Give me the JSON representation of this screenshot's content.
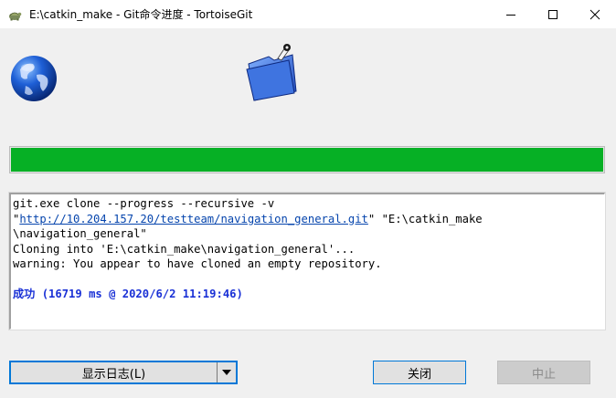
{
  "window": {
    "title": "E:\\catkin_make - Git命令进度 - TortoiseGit",
    "icon": "tortoise-icon",
    "controls": [
      "minimize-icon",
      "maximize-icon",
      "close-icon"
    ]
  },
  "header": {
    "left_icon": "globe-icon",
    "right_icon": "folder-icon"
  },
  "progress": {
    "percent": 100,
    "color": "#06b025"
  },
  "log": {
    "line1": "git.exe clone --progress --recursive -v",
    "line2_q1": "\"",
    "line2_link": "http://10.204.157.20/testteam/navigation_general.git",
    "line2_rest": "\" \"E:\\catkin_make",
    "line3": "\\navigation_general\"",
    "line4": "Cloning into 'E:\\catkin_make\\navigation_general'...",
    "line5": "warning: You appear to have cloned an empty repository.",
    "success": "成功 (16719 ms @ 2020/6/2 11:19:46)",
    "success_color": "#1a31d6"
  },
  "buttons": {
    "show_log": "显示日志(L)",
    "close": "关闭",
    "abort": "中止"
  }
}
